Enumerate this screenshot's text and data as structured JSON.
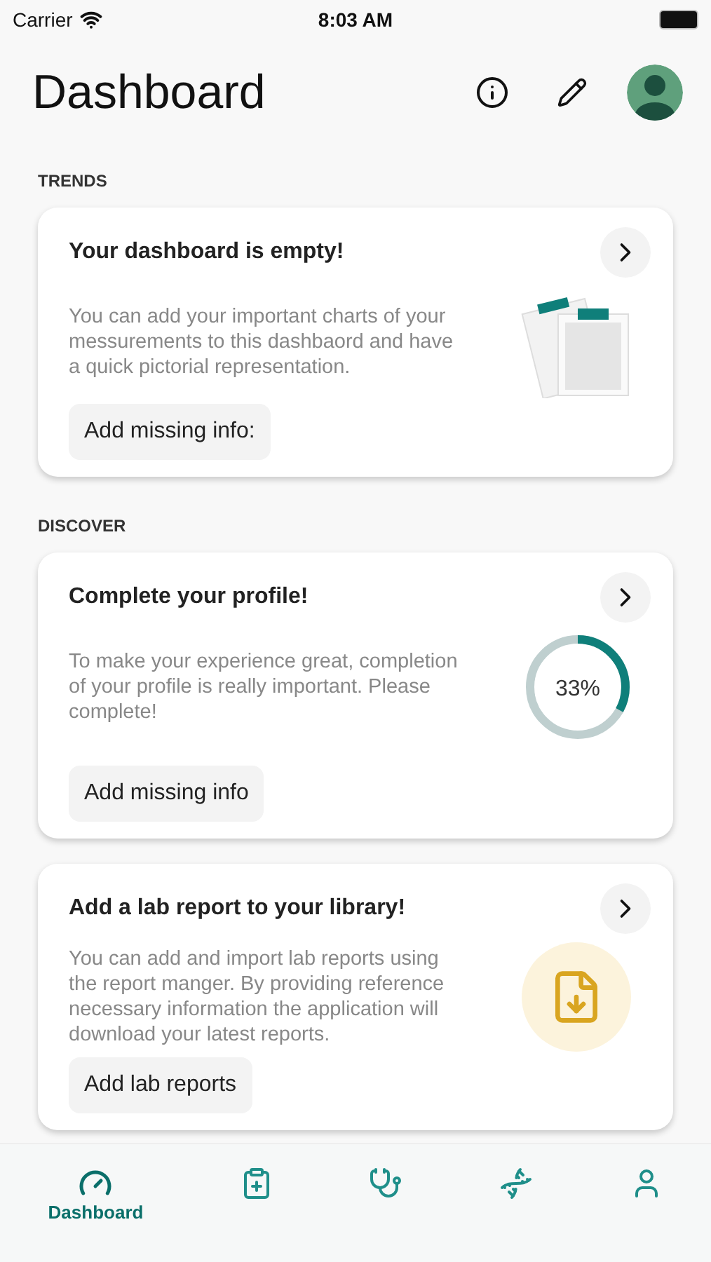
{
  "status_bar": {
    "carrier": "Carrier",
    "time": "8:03 AM"
  },
  "header": {
    "title": "Dashboard"
  },
  "sections": [
    {
      "heading": "TRENDS",
      "cards": [
        {
          "kind": "illustration",
          "title": "Your dashboard is empty!",
          "text": "You can add your important charts of your messurements to this dashbaord and have a quick pictorial representation.",
          "button": "Add missing info:"
        }
      ]
    },
    {
      "heading": "DISCOVER",
      "cards": [
        {
          "kind": "progress",
          "title": "Complete your profile!",
          "text": "To make your experience great, completion of your profile is really important. Please complete!",
          "button": "Add missing info",
          "reading": "33%"
        },
        {
          "kind": "file",
          "title": "Add a lab report to your library!",
          "text": "You can add and import lab reports using the report manger. By providing reference necessary information the application will download your latest reports.",
          "button": "Add lab reports"
        }
      ]
    }
  ],
  "tab_bar": [
    {
      "kind": "dashboard",
      "label": "Dashboard",
      "selected": true
    },
    {
      "kind": "records",
      "selected": false
    },
    {
      "kind": "doctor",
      "selected": false
    },
    {
      "kind": "molecule",
      "selected": false
    },
    {
      "kind": "profile",
      "selected": false
    }
  ]
}
